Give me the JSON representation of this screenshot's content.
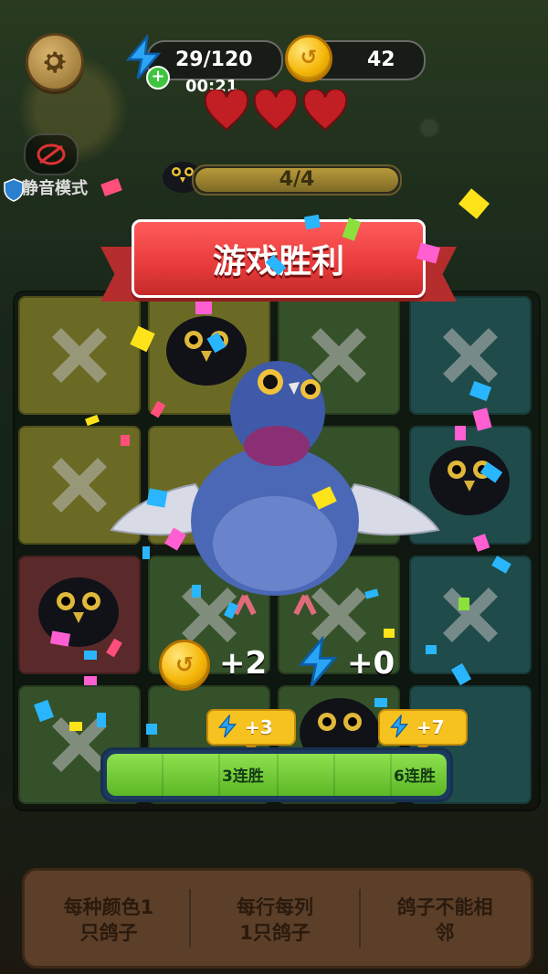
{
  "hud": {
    "energy_value": "29/120",
    "timer": "00:21",
    "coins_value": "42",
    "mute_label": "静音模式",
    "level_progress": "4/4"
  },
  "banner": {
    "title": "游戏胜利"
  },
  "rewards": {
    "coin_reward": "+2",
    "energy_reward": "+0"
  },
  "streak": {
    "tag_3": "+3",
    "tag_6": "+7",
    "label_3": "3连胜",
    "label_6": "6连胜"
  },
  "rules": [
    {
      "line1": "每种颜色1",
      "line2": "只鸽子"
    },
    {
      "line1": "每行每列",
      "line2": "1只鸽子"
    },
    {
      "line1": "鸽子不能相",
      "line2": "邻"
    }
  ],
  "colors": {
    "banner_red": "#e83a3a",
    "coin_gold": "#f5b70a",
    "energy_blue": "#1e8fe6",
    "streak_green": "#5cb825"
  },
  "icons": [
    "gear-icon",
    "bolt-icon",
    "coin-icon",
    "heart-icon",
    "shield-icon",
    "close-x-icon",
    "pigeon-icon"
  ]
}
